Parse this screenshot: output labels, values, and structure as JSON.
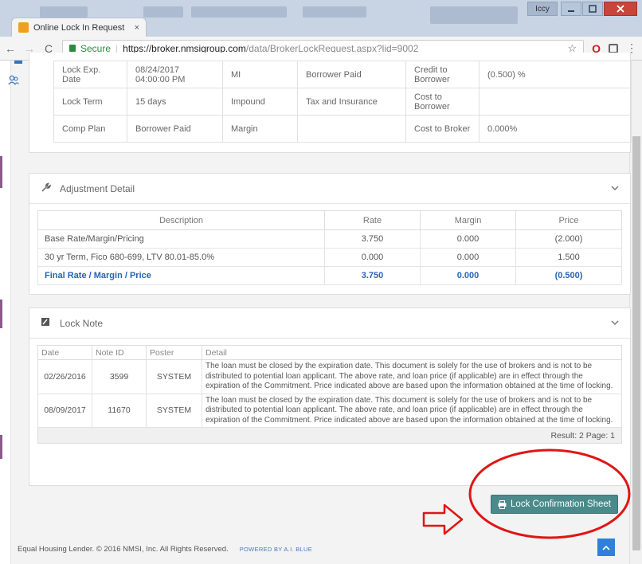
{
  "browser": {
    "tab_title": "Online Lock In Request",
    "tab_close": "×",
    "secure_label": "Secure",
    "url_host": "https://broker.nmsigroup.com",
    "url_path": "/data/BrokerLockRequest.aspx?lid=9002",
    "user_label": "Iccy",
    "back": "←",
    "forward": "→",
    "reload": "C",
    "star": "☆",
    "menu": "⋮"
  },
  "lock_info": {
    "rows": [
      [
        {
          "v": "Lock Exp. Date"
        },
        {
          "v": "08/24/2017 04:00:00 PM"
        },
        {
          "v": "MI"
        },
        {
          "v": "Borrower Paid"
        },
        {
          "v": "Credit to Borrower"
        },
        {
          "v": "(0.500) %"
        }
      ],
      [
        {
          "v": "Lock Term"
        },
        {
          "v": "15 days"
        },
        {
          "v": "Impound"
        },
        {
          "v": "Tax and Insurance"
        },
        {
          "v": "Cost to Borrower"
        },
        {
          "v": ""
        }
      ],
      [
        {
          "v": "Comp Plan"
        },
        {
          "v": "Borrower Paid"
        },
        {
          "v": "Margin"
        },
        {
          "v": ""
        },
        {
          "v": "Cost to Broker"
        },
        {
          "v": "0.000%"
        }
      ]
    ]
  },
  "adjustment": {
    "title": "Adjustment Detail",
    "headers": [
      "Description",
      "Rate",
      "Margin",
      "Price"
    ],
    "rows": [
      {
        "description": "Base Rate/Margin/Pricing",
        "rate": "3.750",
        "margin": "0.000",
        "price": "(2.000)"
      },
      {
        "description": "30 yr Term, Fico 680-699, LTV 80.01-85.0%",
        "rate": "0.000",
        "margin": "0.000",
        "price": "1.500"
      }
    ],
    "final": {
      "description": "Final Rate / Margin / Price",
      "rate": "3.750",
      "margin": "0.000",
      "price": "(0.500)"
    }
  },
  "lock_note": {
    "title": "Lock Note",
    "headers": [
      "Date",
      "Note ID",
      "Poster",
      "Detail"
    ],
    "rows": [
      {
        "date": "02/26/2016",
        "note_id": "3599",
        "poster": "SYSTEM",
        "detail": "The loan must be closed by the expiration date. This document is solely for the use of brokers and is not to be distributed to potential loan applicant. The above rate, and loan price (if applicable) are in effect through the expiration of the Commitment. Price indicated above are based upon the information obtained at the time of locking."
      },
      {
        "date": "08/09/2017",
        "note_id": "11670",
        "poster": "SYSTEM",
        "detail": "The loan must be closed by the expiration date. This document is solely for the use of brokers and is not to be distributed to potential loan applicant. The above rate, and loan price (if applicable) are in effect through the expiration of the Commitment. Price indicated above are based upon the information obtained at the time of locking."
      }
    ],
    "result": "Result: 2  Page: 1"
  },
  "lock_button_label": "Lock Confirmation Sheet",
  "footer": {
    "copyright": "Equal Housing Lender. © 2016 NMSI, Inc. All Rights Reserved.",
    "powered": "POWERED BY A.I. BLUE"
  },
  "colors": {
    "accent_blue": "#2a63b0",
    "button_teal": "#4a8a8a",
    "annotation_red": "#e01515"
  }
}
